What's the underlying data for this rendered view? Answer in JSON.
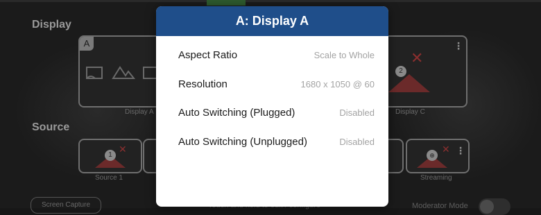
{
  "modal": {
    "title": "A: Display A",
    "rows": [
      {
        "label": "Aspect Ratio",
        "value": "Scale to Whole"
      },
      {
        "label": "Resolution",
        "value": "1680 x 1050 @ 60"
      },
      {
        "label": "Auto Switching (Plugged)",
        "value": "Disabled"
      },
      {
        "label": "Auto Switching (Unplugged)",
        "value": "Disabled"
      }
    ],
    "header_color": "#1f4e8a"
  },
  "background": {
    "display_section_title": "Display",
    "source_section_title": "Source",
    "display_a": {
      "tag": "A",
      "caption": "Display A"
    },
    "display_c": {
      "badge": "2",
      "caption": "Display C"
    },
    "sources": [
      {
        "badge": "1",
        "caption": "Source 1"
      },
      {
        "caption": "Streaming"
      }
    ],
    "footer_button": "Screen Capture",
    "footer_center": "Touch and hold to edit / configure",
    "moderator_label": "Moderator Mode"
  }
}
